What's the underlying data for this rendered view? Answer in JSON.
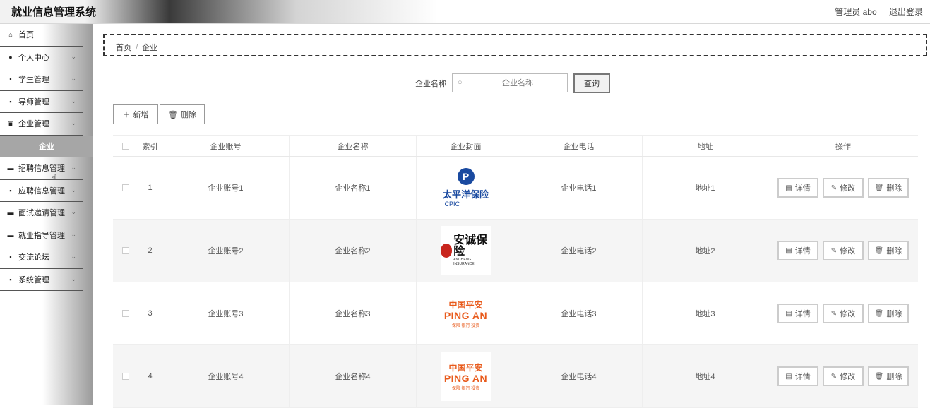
{
  "app": {
    "title": "就业信息管理系统",
    "user_label": "管理员 abo",
    "logout_label": "退出登录"
  },
  "sidebar": {
    "items": [
      {
        "label": "首页",
        "icon": "home-icon",
        "glyph": "⌂",
        "chevron": false
      },
      {
        "label": "个人中心",
        "icon": "user-icon",
        "glyph": "●",
        "chevron": true
      },
      {
        "label": "学生管理",
        "icon": "grid-icon",
        "glyph": "▪",
        "chevron": true
      },
      {
        "label": "导师管理",
        "icon": "grid-icon",
        "glyph": "▪",
        "chevron": true
      },
      {
        "label": "企业管理",
        "icon": "building-icon",
        "glyph": "▣",
        "chevron": true
      },
      {
        "label": "企业",
        "active": true
      },
      {
        "label": "招聘信息管理",
        "icon": "doc-icon",
        "glyph": "▬",
        "chevron": true
      },
      {
        "label": "应聘信息管理",
        "icon": "grid-icon",
        "glyph": "▪",
        "chevron": true
      },
      {
        "label": "面试邀请管理",
        "icon": "chat-icon",
        "glyph": "▬",
        "chevron": true
      },
      {
        "label": "就业指导管理",
        "icon": "chat-icon",
        "glyph": "▬",
        "chevron": true
      },
      {
        "label": "交流论坛",
        "icon": "grid-icon",
        "glyph": "▪",
        "chevron": true
      },
      {
        "label": "系统管理",
        "icon": "grid-icon",
        "glyph": "▪",
        "chevron": true
      }
    ]
  },
  "breadcrumb": {
    "home": "首页",
    "separator": "/",
    "current": "企业"
  },
  "search": {
    "label": "企业名称",
    "placeholder": "企业名称",
    "button": "查询"
  },
  "toolbar": {
    "add_label": "新增",
    "delete_label": "删除"
  },
  "table": {
    "headers": [
      "索引",
      "企业账号",
      "企业名称",
      "企业封面",
      "企业电话",
      "地址",
      "操作"
    ],
    "actions": {
      "detail": "详情",
      "edit": "修改",
      "delete": "删除"
    },
    "rows": [
      {
        "index": "1",
        "account": "企业账号1",
        "name": "企业名称1",
        "phone": "企业电话1",
        "address": "地址1",
        "logo": {
          "type": "cpic",
          "line1": "太平洋保险",
          "line2": "CPIC",
          "mark": "P"
        }
      },
      {
        "index": "2",
        "account": "企业账号2",
        "name": "企业名称2",
        "phone": "企业电话2",
        "address": "地址2",
        "logo": {
          "type": "anchen",
          "line1": "安诚保险",
          "line2": "ANCHENG INSURANCE"
        }
      },
      {
        "index": "3",
        "account": "企业账号3",
        "name": "企业名称3",
        "phone": "企业电话3",
        "address": "地址3",
        "logo": {
          "type": "pingan",
          "line1": "中国平安",
          "line2": "PING AN",
          "line3": "保险 银行 投资"
        }
      },
      {
        "index": "4",
        "account": "企业账号4",
        "name": "企业名称4",
        "phone": "企业电话4",
        "address": "地址4",
        "logo": {
          "type": "pingan",
          "line1": "中国平安",
          "line2": "PING AN",
          "line3": "保险 银行 投资"
        }
      }
    ]
  },
  "colors": {
    "accent_blue": "#1a4aa0",
    "pingan_orange": "#e85a1b",
    "anchen_red": "#c8251d"
  }
}
